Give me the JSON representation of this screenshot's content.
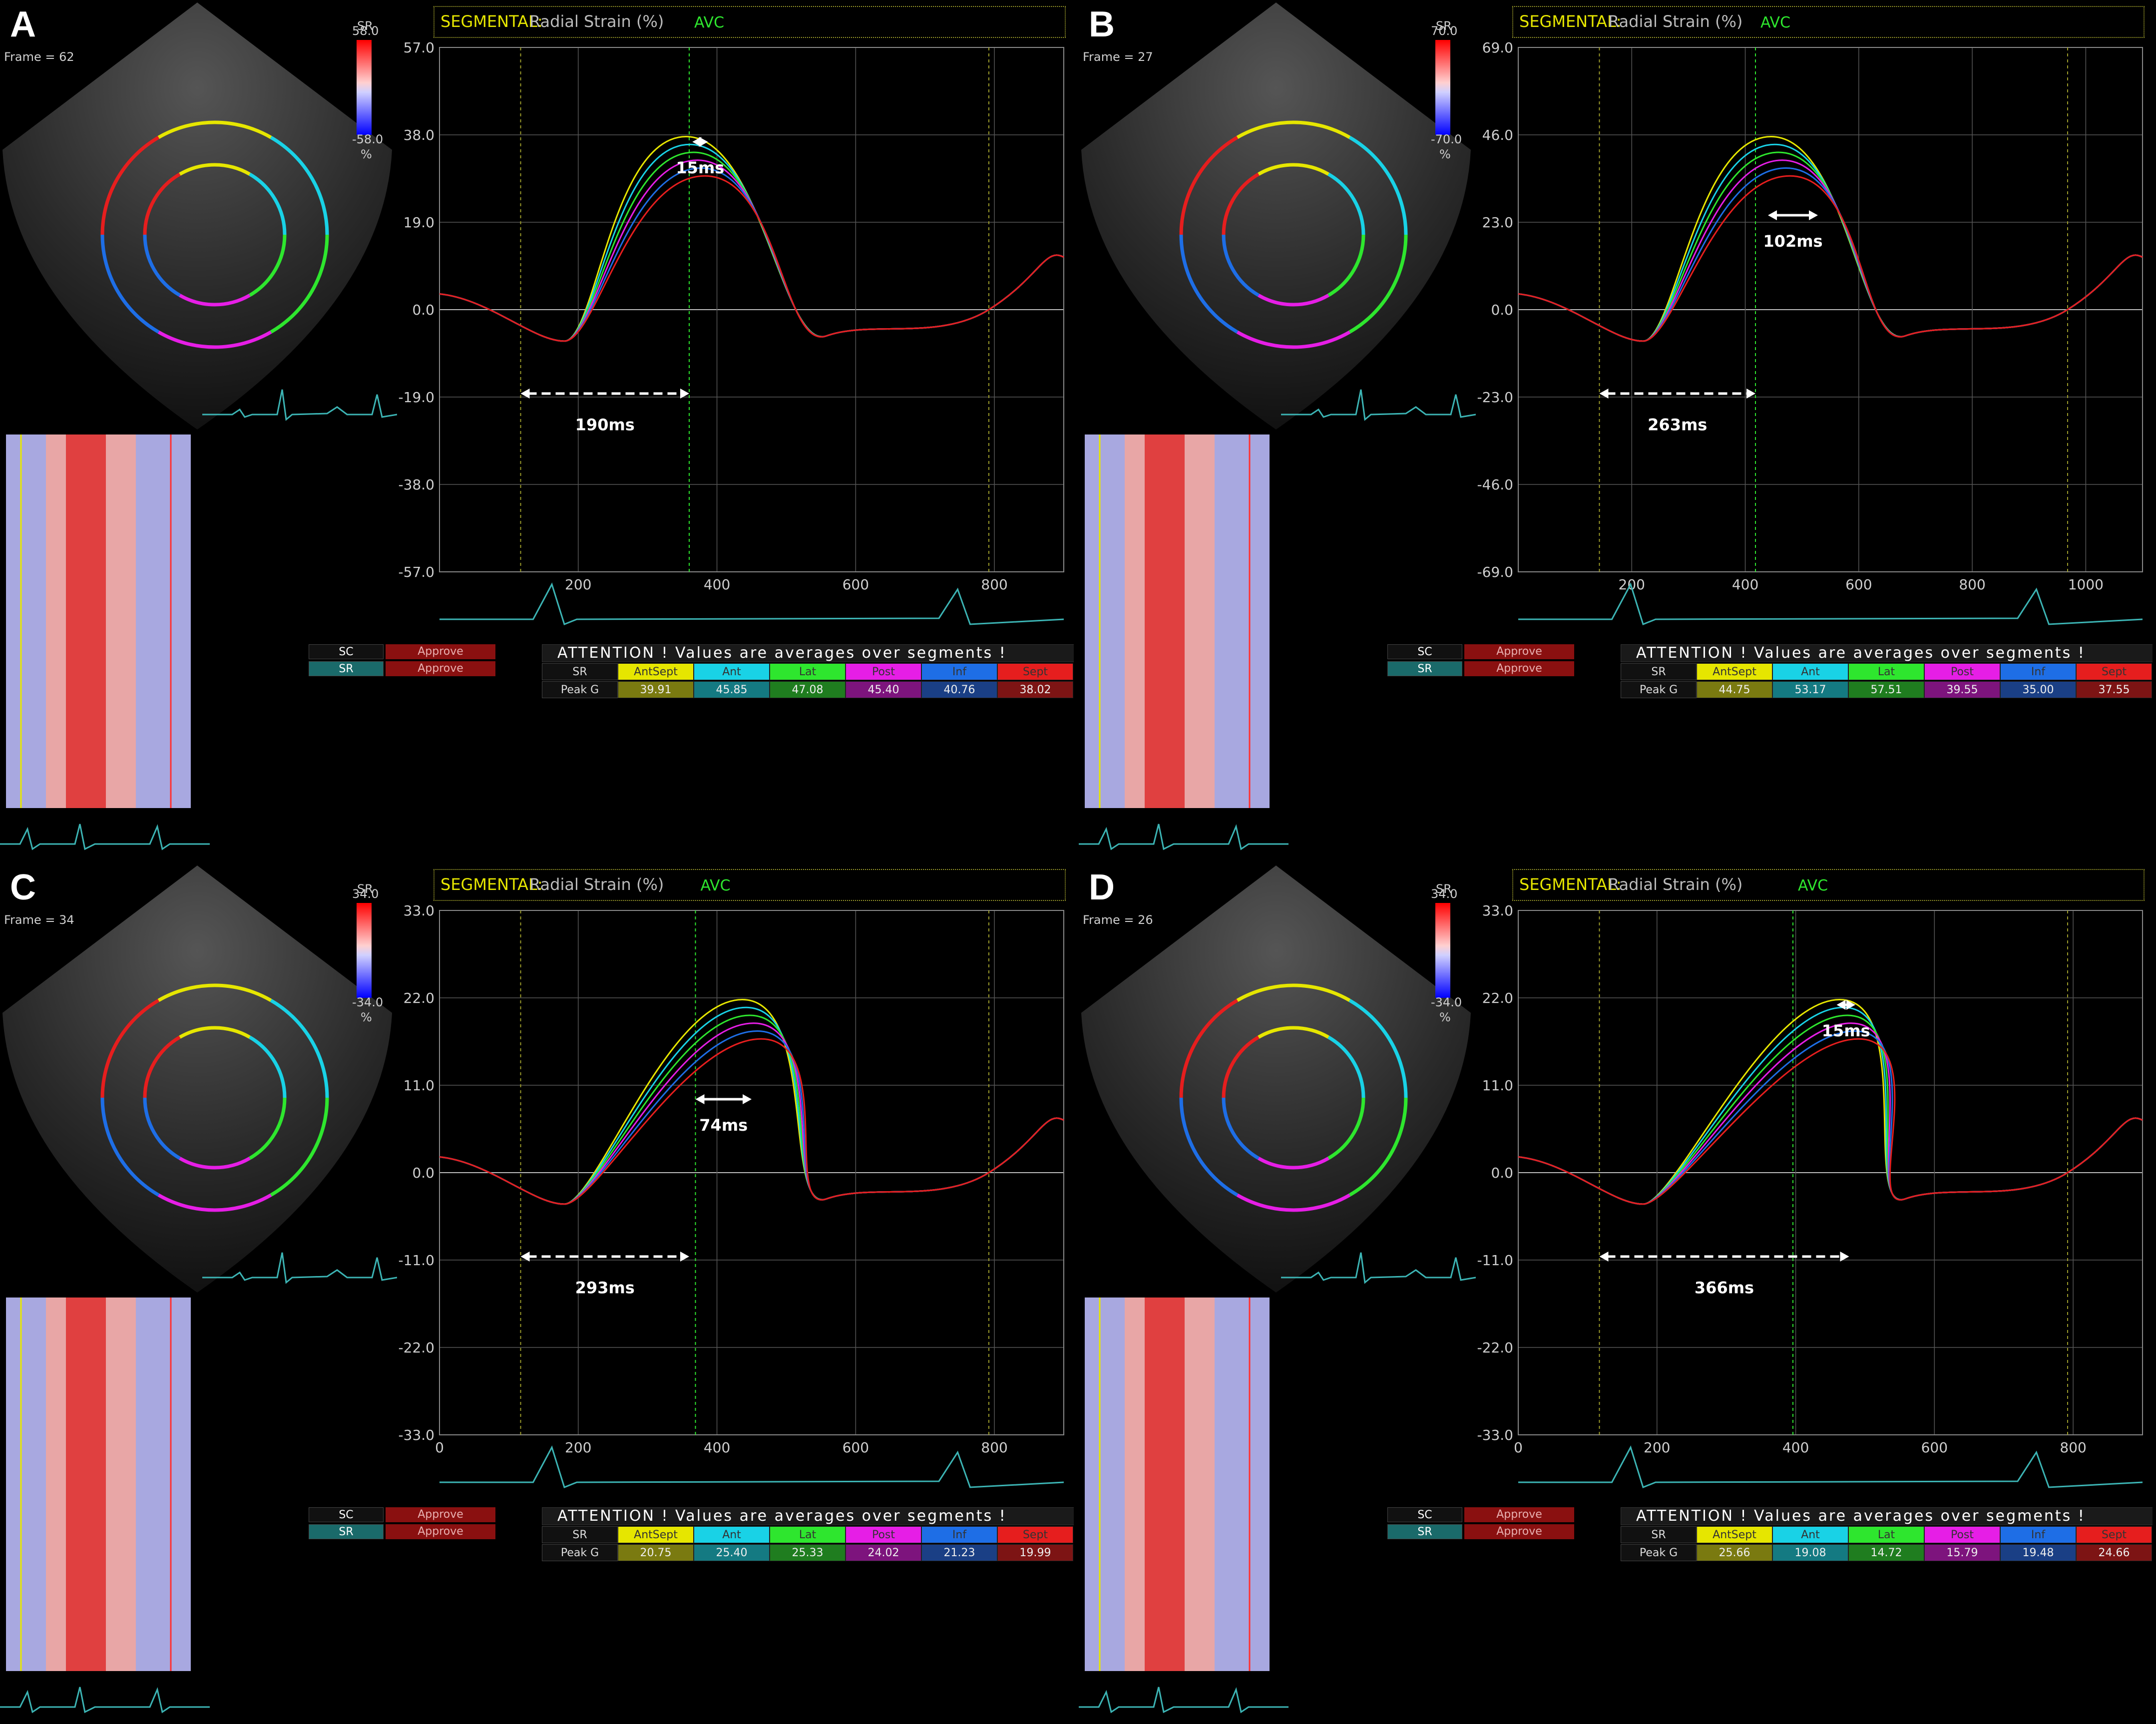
{
  "panels": [
    {
      "letter": "A",
      "frame": "Frame = 62",
      "sr_title": "SR",
      "sr_top": "58.0",
      "sr_bottom": "-58.0",
      "sr_unit": "%",
      "header": {
        "segmental": "SEGMENTAL:",
        "measure": "Radial Strain (%)"
      },
      "avc": "AVC",
      "yticks": [
        "57.0",
        "38.0",
        "19.0",
        "0.0",
        "-19.0",
        "-38.0",
        "-57.0"
      ],
      "xticks": [
        "200",
        "400",
        "600",
        "800"
      ],
      "meas_short": "15ms",
      "meas_long": "190ms",
      "controls": {
        "sc": "SC",
        "sr": "SR",
        "approve1": "Approve",
        "approve2": "Approve"
      },
      "attention": "ATTENTION !  Values are averages over segments !",
      "row_sr": "SR",
      "row_peak": "Peak G",
      "segments": [
        "AntSept",
        "Ant",
        "Lat",
        "Post",
        "Inf",
        "Sept"
      ],
      "values": [
        "39.91",
        "45.85",
        "47.08",
        "45.40",
        "40.76",
        "38.02"
      ]
    },
    {
      "letter": "B",
      "frame": "Frame = 27",
      "sr_title": "SR",
      "sr_top": "70.0",
      "sr_bottom": "-70.0",
      "sr_unit": "%",
      "header": {
        "segmental": "SEGMENTAL:",
        "measure": "Radial Strain (%)"
      },
      "avc": "AVC",
      "yticks": [
        "69.0",
        "46.0",
        "23.0",
        "0.0",
        "-23.0",
        "-46.0",
        "-69.0"
      ],
      "xticks": [
        "200",
        "400",
        "600",
        "800",
        "1000"
      ],
      "meas_short": "102ms",
      "meas_long": "263ms",
      "controls": {
        "sc": "SC",
        "sr": "SR",
        "approve1": "Approve",
        "approve2": "Approve"
      },
      "attention": "ATTENTION !  Values are averages over segments !",
      "row_sr": "SR",
      "row_peak": "Peak G",
      "segments": [
        "AntSept",
        "Ant",
        "Lat",
        "Post",
        "Inf",
        "Sept"
      ],
      "values": [
        "44.75",
        "53.17",
        "57.51",
        "39.55",
        "35.00",
        "37.55"
      ]
    },
    {
      "letter": "C",
      "frame": "Frame = 34",
      "sr_title": "SR",
      "sr_top": "34.0",
      "sr_bottom": "-34.0",
      "sr_unit": "%",
      "header": {
        "segmental": "SEGMENTAL:",
        "measure": "Radial Strain (%)"
      },
      "avc": "AVC",
      "yticks": [
        "33.0",
        "22.0",
        "11.0",
        "0.0",
        "-11.0",
        "-22.0",
        "-33.0"
      ],
      "xticks": [
        "0",
        "200",
        "400",
        "600",
        "800"
      ],
      "meas_short": "74ms",
      "meas_long": "293ms",
      "controls": {
        "sc": "SC",
        "sr": "SR",
        "approve1": "Approve",
        "approve2": "Approve"
      },
      "attention": "ATTENTION !  Values are averages over segments !",
      "row_sr": "SR",
      "row_peak": "Peak G",
      "segments": [
        "AntSept",
        "Ant",
        "Lat",
        "Post",
        "Inf",
        "Sept"
      ],
      "values": [
        "20.75",
        "25.40",
        "25.33",
        "24.02",
        "21.23",
        "19.99"
      ]
    },
    {
      "letter": "D",
      "frame": "Frame = 26",
      "sr_title": "SR",
      "sr_top": "34.0",
      "sr_bottom": "-34.0",
      "sr_unit": "%",
      "header": {
        "segmental": "SEGMENTAL:",
        "measure": "Radial Strain (%)"
      },
      "avc": "AVC",
      "yticks": [
        "33.0",
        "22.0",
        "11.0",
        "0.0",
        "-11.0",
        "-22.0",
        "-33.0"
      ],
      "xticks": [
        "0",
        "200",
        "400",
        "600",
        "800"
      ],
      "meas_short": "15ms",
      "meas_long": "366ms",
      "controls": {
        "sc": "SC",
        "sr": "SR",
        "approve1": "Approve",
        "approve2": "Approve"
      },
      "attention": "ATTENTION !  Values are averages over segments !",
      "row_sr": "SR",
      "row_peak": "Peak G",
      "segments": [
        "AntSept",
        "Ant",
        "Lat",
        "Post",
        "Inf",
        "Sept"
      ],
      "values": [
        "25.66",
        "19.08",
        "14.72",
        "15.79",
        "19.48",
        "24.66"
      ]
    }
  ],
  "segment_colors": {
    "AntSept": "#e6e600",
    "Ant": "#19d2e6",
    "Lat": "#2ee62e",
    "Post": "#e61ee6",
    "Inf": "#1e6ee6",
    "Sept": "#e61e1e"
  }
}
